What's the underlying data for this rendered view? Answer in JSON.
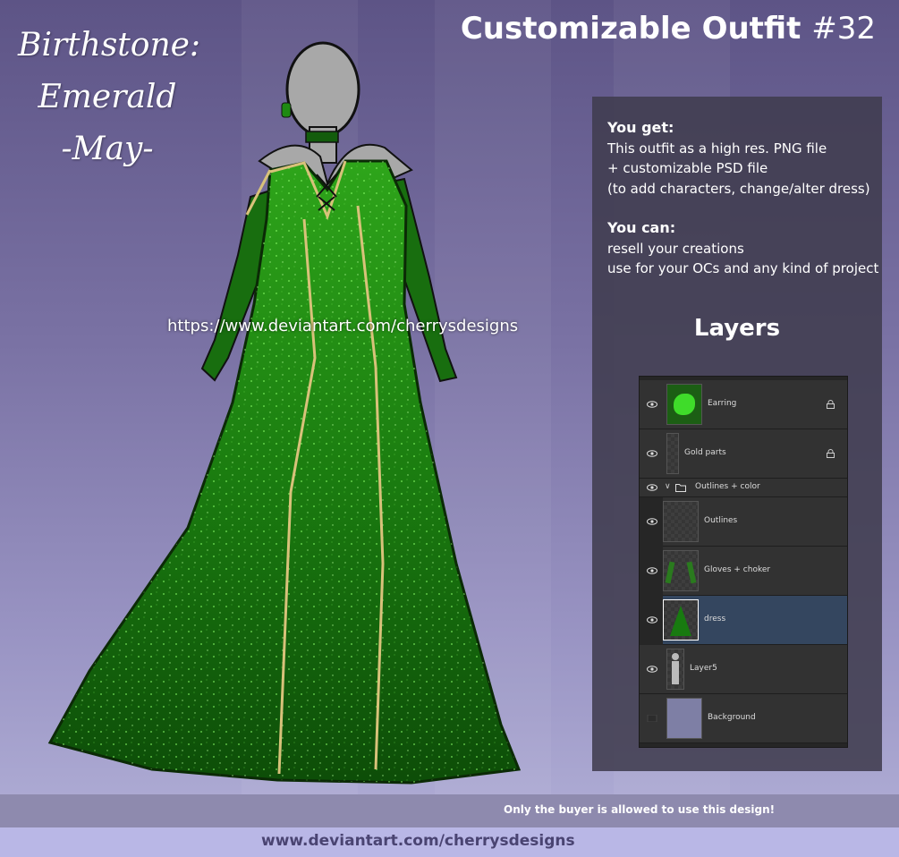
{
  "headline": {
    "script_lines": [
      "Birthstone:",
      "Emerald",
      "-May-"
    ],
    "title_main": "Customizable Outfit",
    "title_number": "#32"
  },
  "info": {
    "you_get_heading": "You get:",
    "you_get_lines": [
      "This outfit as a high res. PNG file",
      "+ customizable PSD file",
      "(to add characters, change/alter dress)"
    ],
    "you_can_heading": "You can:",
    "you_can_lines": [
      "resell your creations",
      "use for your OCs and any kind of project"
    ],
    "layers_heading": "Layers"
  },
  "layers": [
    {
      "name": "Earring",
      "locked": true,
      "visible": true,
      "selected": false,
      "indent": false,
      "thumb_icon": "green-stone-icon"
    },
    {
      "name": "Gold parts",
      "locked": true,
      "visible": true,
      "selected": false,
      "indent": false,
      "thumb_icon": "gold-lines-icon"
    },
    {
      "name": "Outlines + color",
      "group": true,
      "visible": true,
      "selected": false,
      "indent": false,
      "thumb_icon": "folder-icon"
    },
    {
      "name": "Outlines",
      "locked": false,
      "visible": true,
      "selected": false,
      "indent": true,
      "thumb_icon": "outline-icon"
    },
    {
      "name": "Gloves + choker",
      "locked": false,
      "visible": true,
      "selected": false,
      "indent": true,
      "thumb_icon": "gloves-icon"
    },
    {
      "name": "dress",
      "locked": false,
      "visible": true,
      "selected": true,
      "indent": true,
      "thumb_icon": "dress-icon"
    },
    {
      "name": "Layer5",
      "locked": false,
      "visible": true,
      "selected": false,
      "indent": false,
      "thumb_icon": "mannequin-icon"
    },
    {
      "name": "Background",
      "locked": false,
      "visible": false,
      "selected": false,
      "indent": false,
      "thumb_icon": "background-swatch-icon"
    }
  ],
  "watermark": "https://www.deviantart.com/cherrysdesigns",
  "footer": {
    "notice": "Only the buyer is allowed to use this design!",
    "url": "www.deviantart.com/cherrysdesigns"
  },
  "colors": {
    "dress": "#1f8a12",
    "gold": "#d8c27a",
    "skin": "#a8a8a8",
    "selected_layer": "#34465f"
  }
}
